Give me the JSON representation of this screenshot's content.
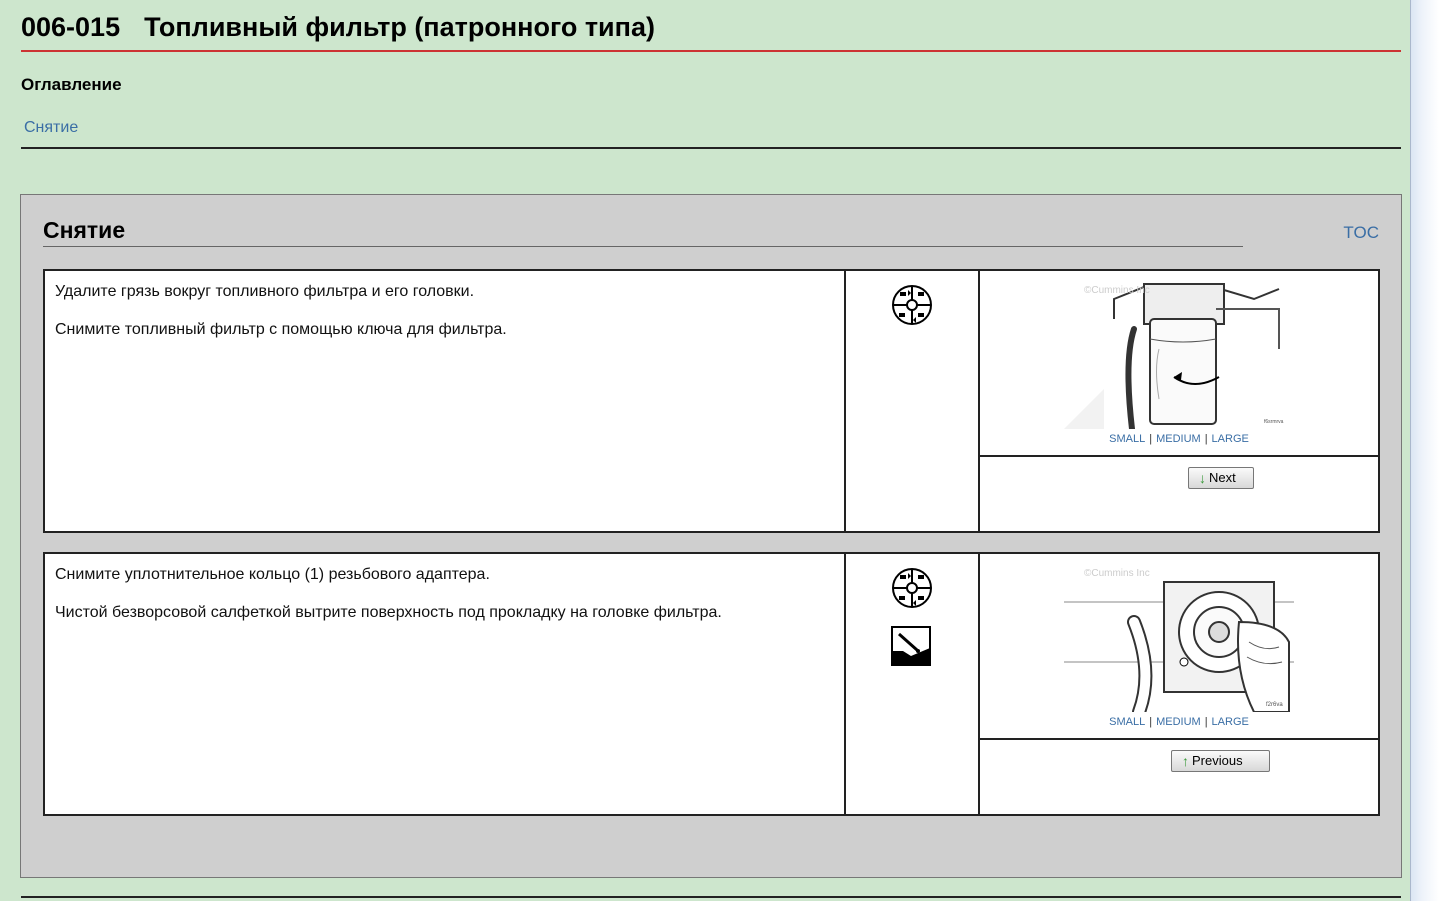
{
  "page": {
    "code": "006-015",
    "title": "Топливный фильтр (патронного типа)",
    "toc_heading": "Оглавление",
    "toc_links": [
      "Снятие"
    ]
  },
  "section": {
    "title": "Снятие",
    "toc_link": "TOC",
    "image_size_links": [
      "SMALL",
      "MEDIUM",
      "LARGE"
    ],
    "image_watermark": "©Cummins Inc",
    "steps": [
      {
        "paragraphs": [
          "Удалите грязь вокруг топливного фильтра и его головки.",
          "Снимите топливный фильтр с помощью ключа для фильтра."
        ],
        "icons": [
          "gear-wheel-icon"
        ],
        "image_label": "f6srmrva",
        "nav_label": "Next"
      },
      {
        "paragraphs": [
          "Снимите уплотнительное кольцо (1) резьбового адаптера.",
          "Чистой безворсовой салфеткой вытрите поверхность под прокладку на головке фильтра."
        ],
        "icons": [
          "gear-wheel-icon",
          "wipe-cloth-icon"
        ],
        "image_label": "f2r6va",
        "nav_label": "Previous"
      }
    ]
  },
  "colors": {
    "page_bg": "#cde6cd",
    "section_bg": "#cfcfcf",
    "title_rule": "#cc3333",
    "link": "#3a6ea5"
  }
}
